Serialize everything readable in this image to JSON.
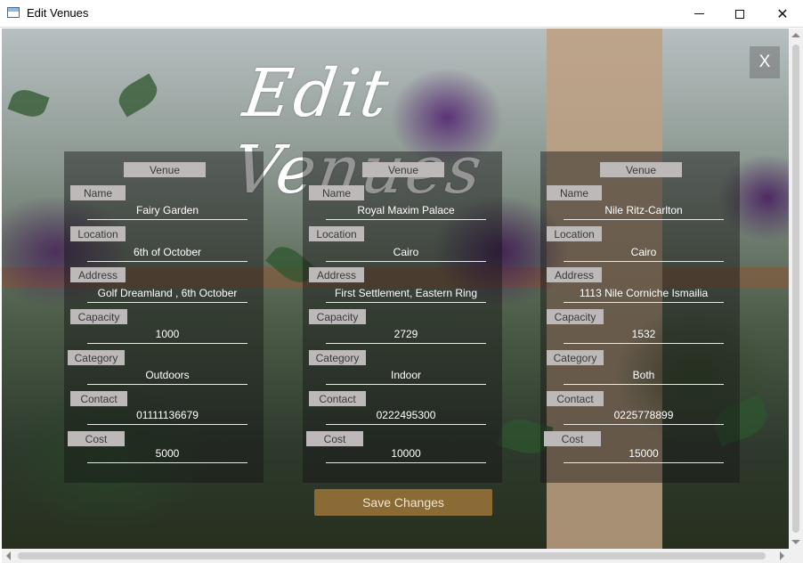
{
  "window": {
    "title": "Edit Venues",
    "icon": "app-window-icon",
    "controls": {
      "minimize": "minimize-icon",
      "maximize": "maximize-icon",
      "close": "close-icon"
    }
  },
  "page": {
    "heading": "Edit Venues",
    "close_label": "X",
    "save_label": "Save Changes",
    "colors": {
      "accent": "#8a6a35",
      "label_bg": "#bdb9b9"
    }
  },
  "venues": [
    {
      "header": "Venue",
      "labels": {
        "name": "Name",
        "location": "Location",
        "address": "Address",
        "capacity": "Capacity",
        "category": "Category",
        "contact": "Contact",
        "cost": "Cost"
      },
      "name": "Fairy Garden",
      "location": "6th of October",
      "address": "Golf Dreamland , 6th October",
      "capacity": "1000",
      "category": "Outdoors",
      "contact": "01111136679",
      "cost": "5000"
    },
    {
      "header": "Venue",
      "labels": {
        "name": "Name",
        "location": "Location",
        "address": "Address",
        "capacity": "Capacity",
        "category": "Category",
        "contact": "Contact",
        "cost": "Cost"
      },
      "name": "Royal Maxim Palace",
      "location": "Cairo",
      "address": "First Settlement, Eastern Ring",
      "capacity": "2729",
      "category": "Indoor",
      "contact": "0222495300",
      "cost": "10000"
    },
    {
      "header": "Venue",
      "labels": {
        "name": "Name",
        "location": "Location",
        "address": "Address",
        "capacity": "Capacity",
        "category": "Category",
        "contact": "Contact",
        "cost": "Cost"
      },
      "name": "Nile Ritz-Carlton",
      "location": "Cairo",
      "address": "1113 Nile Corniche Ismailia",
      "capacity": "1532",
      "category": "Both",
      "contact": "0225778899",
      "cost": "15000"
    }
  ]
}
